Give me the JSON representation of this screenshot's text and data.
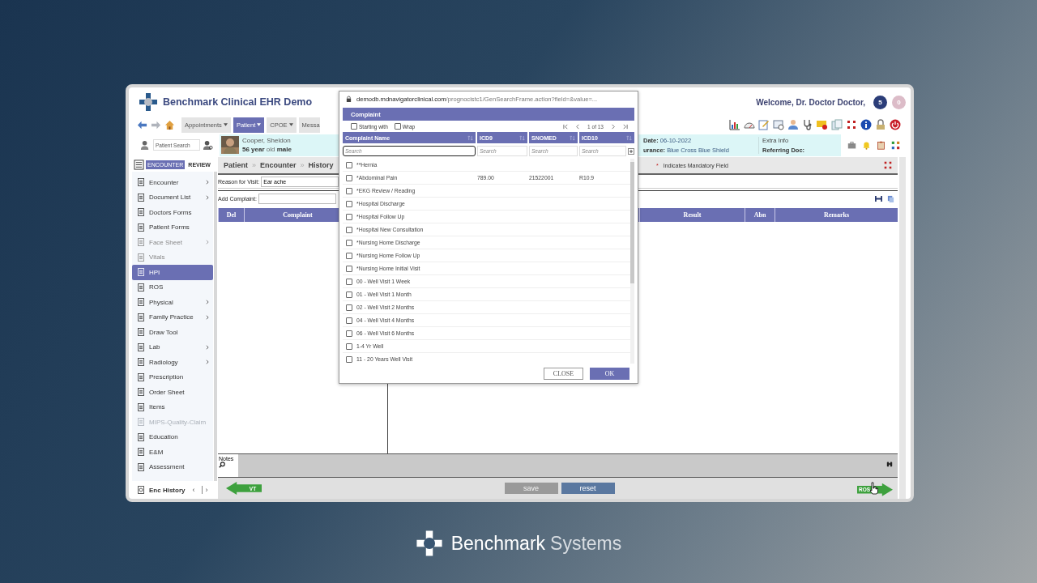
{
  "app": {
    "title": "Benchmark Clinical EHR Demo",
    "welcome": "Welcome, Dr. Doctor Doctor,",
    "badges": [
      {
        "text": "5",
        "color": "#2b3d78"
      },
      {
        "text": "0",
        "color": "#dcbcc8"
      }
    ]
  },
  "nav": {
    "tabs": [
      {
        "label": "Appointments",
        "selected": false,
        "dropdown": true
      },
      {
        "label": "Patient",
        "selected": true,
        "dropdown": true
      },
      {
        "label": "CPOE",
        "selected": false,
        "dropdown": true
      },
      {
        "label": "Messa",
        "selected": false,
        "dropdown": false
      }
    ]
  },
  "patient": {
    "search_placeholder": "Patient Search",
    "name": "Cooper, Sheldon",
    "summary": "**56 year** old **male**",
    "date_label": "Date:",
    "date": "06-10-2022",
    "insurance_label": "urance:",
    "insurance": "Blue Cross Blue Shield",
    "extra_info": "Extra Info",
    "referring_label": "Referring Doc:"
  },
  "sidebar": {
    "modes": [
      {
        "label": "ENCOUNTER",
        "selected": true
      },
      {
        "label": "REVIEW",
        "selected": false
      }
    ],
    "items": [
      {
        "label": "Encounter",
        "submenu": true,
        "selected": false,
        "muted": false,
        "disabled": false
      },
      {
        "label": "Document List",
        "submenu": true,
        "selected": false,
        "muted": false,
        "disabled": false
      },
      {
        "label": "Doctors Forms",
        "submenu": false,
        "selected": false,
        "muted": false,
        "disabled": false
      },
      {
        "label": "Patient Forms",
        "submenu": false,
        "selected": false,
        "muted": false,
        "disabled": false
      },
      {
        "label": "Face Sheet",
        "submenu": true,
        "selected": false,
        "muted": true,
        "disabled": false
      },
      {
        "label": "Vitals",
        "submenu": false,
        "selected": false,
        "muted": true,
        "disabled": false
      },
      {
        "label": "HPI",
        "submenu": false,
        "selected": true,
        "muted": false,
        "disabled": false
      },
      {
        "label": "ROS",
        "submenu": false,
        "selected": false,
        "muted": false,
        "disabled": false
      },
      {
        "label": "Physical",
        "submenu": true,
        "selected": false,
        "muted": false,
        "disabled": false
      },
      {
        "label": "Family Practice",
        "submenu": true,
        "selected": false,
        "muted": false,
        "disabled": false
      },
      {
        "label": "Draw Tool",
        "submenu": false,
        "selected": false,
        "muted": false,
        "disabled": false
      },
      {
        "label": "Lab",
        "submenu": true,
        "selected": false,
        "muted": false,
        "disabled": false
      },
      {
        "label": "Radiology",
        "submenu": true,
        "selected": false,
        "muted": false,
        "disabled": false
      },
      {
        "label": "Prescription",
        "submenu": false,
        "selected": false,
        "muted": false,
        "disabled": false
      },
      {
        "label": "Order Sheet",
        "submenu": false,
        "selected": false,
        "muted": false,
        "disabled": false
      },
      {
        "label": "Items",
        "submenu": false,
        "selected": false,
        "muted": false,
        "disabled": false
      },
      {
        "label": "MIPS-Quality-Claim",
        "submenu": false,
        "selected": false,
        "muted": false,
        "disabled": true
      },
      {
        "label": "Education",
        "submenu": false,
        "selected": false,
        "muted": false,
        "disabled": false
      },
      {
        "label": "E&M",
        "submenu": false,
        "selected": false,
        "muted": false,
        "disabled": false
      },
      {
        "label": "Assessment",
        "submenu": false,
        "selected": false,
        "muted": false,
        "disabled": false
      }
    ],
    "footer": {
      "label": "Enc History",
      "prev": "‹",
      "next": "›"
    }
  },
  "breadcrumb": [
    {
      "label": "Patient",
      "separator": "»"
    },
    {
      "label": "Encounter",
      "separator": "»"
    },
    {
      "label": "History"
    }
  ],
  "mandatory_note": {
    "mark": "*",
    "text": "Indicates Mandatory Field"
  },
  "form": {
    "reason_label": "Reason for Visit:",
    "reason_value": "Ear ache",
    "complaint_label": "Add Complaint:"
  },
  "table": {
    "columns": [
      "Del",
      "Complaint",
      "Result",
      "Abn",
      "Remarks"
    ]
  },
  "notes": {
    "label": "Notes"
  },
  "footer": {
    "prev": "VT",
    "save": {
      "label": "save",
      "disabled": true
    },
    "reset": {
      "label": "reset",
      "disabled": false
    },
    "next": "ROS"
  },
  "popup": {
    "url_host": "demodb.mdnavigatorclinical.com",
    "url_path": "/prognocistc1/GenSearchFrame.action?field=&value=...",
    "title": "Complaint",
    "options": [
      {
        "label": "Starting with",
        "checked": false
      },
      {
        "label": "Wrap",
        "checked": false
      }
    ],
    "pager": "1 of 13",
    "columns": [
      {
        "label": "Complaint Name",
        "placeholder": "Search"
      },
      {
        "label": "ICD9",
        "placeholder": "Search"
      },
      {
        "label": "SNOMED",
        "placeholder": "Search"
      },
      {
        "label": "ICD10",
        "placeholder": "Search"
      }
    ],
    "rows": [
      {
        "name": "**Hernia",
        "checked": false
      },
      {
        "name": "*Abdominal Pain",
        "icd9": "789.00",
        "snomed": "21522001",
        "icd10": "R10.9",
        "checked": false
      },
      {
        "name": "*EKG Review / Reading",
        "checked": false
      },
      {
        "name": "*Hospital Discharge",
        "checked": false
      },
      {
        "name": "*Hospital Follow Up",
        "checked": false
      },
      {
        "name": "*Hospital New Consultation",
        "checked": false
      },
      {
        "name": "*Nursing Home Discharge",
        "checked": false
      },
      {
        "name": "*Nursing Home Follow Up",
        "checked": false
      },
      {
        "name": "*Nursing Home Initial Visit",
        "checked": false
      },
      {
        "name": "00 - Well Visit 1 Week",
        "checked": false
      },
      {
        "name": "01 - Well Visit 1 Month",
        "checked": false
      },
      {
        "name": "02 - Well Visit 2 Months",
        "checked": false
      },
      {
        "name": "04 - Well Visit 4 Months",
        "checked": false
      },
      {
        "name": "06 - Well Visit 6 Months",
        "checked": false
      },
      {
        "name": "1-4 Yr Well",
        "checked": false
      },
      {
        "name": "11 - 20 Years Well Visit",
        "checked": false
      }
    ],
    "buttons": [
      {
        "label": "CLOSE",
        "kind": "secondary"
      },
      {
        "label": "OK",
        "kind": "primary"
      }
    ]
  },
  "brand": {
    "name": "Benchmark",
    "suffix": "Systems"
  }
}
